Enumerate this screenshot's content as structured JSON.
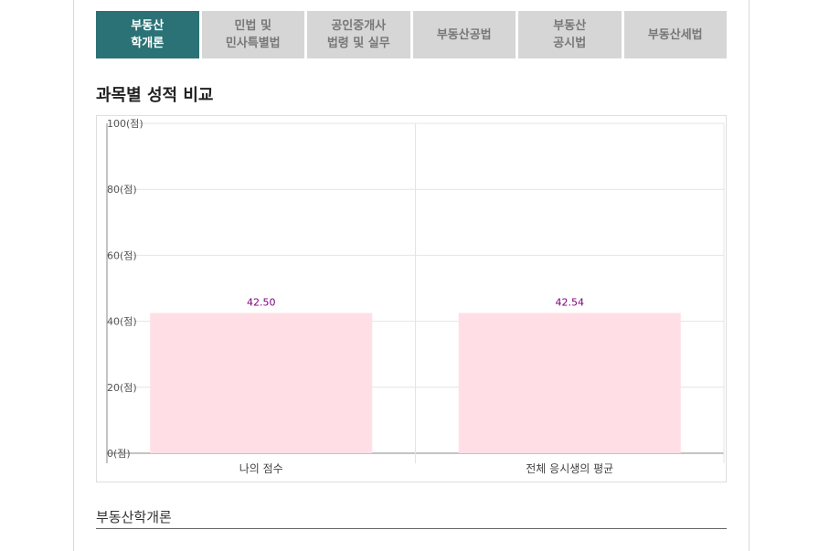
{
  "tabs": [
    {
      "label": "부동산\n학개론",
      "active": true
    },
    {
      "label": "민법 및\n민사특별법",
      "active": false
    },
    {
      "label": "공인중개사\n법령 및 실무",
      "active": false
    },
    {
      "label": "부동산공법",
      "active": false
    },
    {
      "label": "부동산\n공시법",
      "active": false
    },
    {
      "label": "부동산세법",
      "active": false
    }
  ],
  "section_title": "과목별 성적 비교",
  "subject_heading": "부동산학개론",
  "colors": {
    "active_tab": "#2a7276",
    "inactive_tab": "#d6d6d6",
    "bar_fill": "#ffdfe5",
    "value_label": "#800080"
  },
  "chart_data": {
    "type": "bar",
    "categories": [
      "나의 점수",
      "전체 응시생의 평균"
    ],
    "values": [
      42.5,
      42.54
    ],
    "value_labels": [
      "42.50",
      "42.54"
    ],
    "ylim": [
      0,
      100
    ],
    "yticks": [
      0,
      20,
      40,
      60,
      80,
      100
    ],
    "ytick_labels": [
      "0(점)",
      "20(점)",
      "40(점)",
      "60(점)",
      "80(점)",
      "100(점)"
    ],
    "grid": true,
    "legend": "none"
  }
}
